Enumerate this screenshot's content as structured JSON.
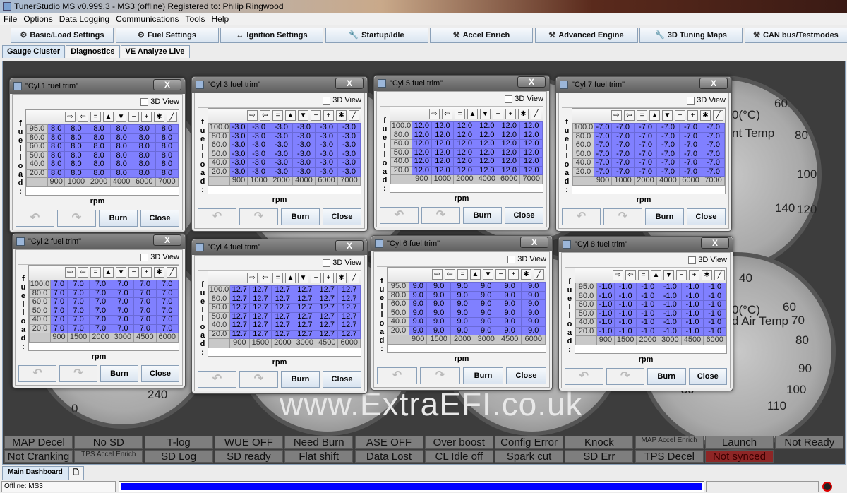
{
  "window_title": "TunerStudio MS v0.999.3 - MS3 (offline) Registered to: Philip Ringwood",
  "menu": [
    "File",
    "Options",
    "Data Logging",
    "Communications",
    "Tools",
    "Help"
  ],
  "toolbar": [
    {
      "label": "Basic/Load Settings",
      "icon": "engine-icon"
    },
    {
      "label": "Fuel Settings",
      "icon": "engine-icon"
    },
    {
      "label": "Ignition Settings",
      "icon": "spark-plug-icon"
    },
    {
      "label": "Startup/Idle",
      "icon": "wrench-icon"
    },
    {
      "label": "Accel Enrich",
      "icon": "tools-icon"
    },
    {
      "label": "Advanced Engine",
      "icon": "hammer-icon"
    },
    {
      "label": "3D Tuning Maps",
      "icon": "wrench-icon"
    },
    {
      "label": "CAN bus/Testmodes",
      "icon": "tools-icon"
    }
  ],
  "tabs": [
    "Gauge Cluster",
    "Diagnostics",
    "VE Analyze Live"
  ],
  "active_tab": "Gauge Cluster",
  "gauges": {
    "texts": [
      "60",
      "80",
      "100",
      "120",
      "140",
      "0(°C)",
      "nt Temp",
      "40",
      "60",
      "70",
      "80",
      "90",
      "100",
      "110",
      "-30",
      "0(°C)",
      "d Air Temp",
      "0",
      "240"
    ]
  },
  "watermark": "www.ExtraEFI.co.uk",
  "trim_common": {
    "view3d": "3D View",
    "xlabel": "rpm",
    "ylabel": "fuelload:",
    "burn": "Burn",
    "close": "Close",
    "close_x": "X",
    "tools": [
      "⇨",
      "⇦",
      "=",
      "▲",
      "▼",
      "−",
      "+",
      "✱",
      "╱"
    ]
  },
  "trims": [
    {
      "title": "\"Cyl 1 fuel trim\"",
      "loads": [
        "95.0",
        "80.0",
        "60.0",
        "50.0",
        "40.0",
        "20.0"
      ],
      "rpms": [
        "900",
        "1000",
        "2000",
        "4000",
        "6000",
        "7000"
      ],
      "value": "8.0"
    },
    {
      "title": "\"Cyl 3 fuel trim\"",
      "loads": [
        "100.0",
        "80.0",
        "60.0",
        "50.0",
        "40.0",
        "20.0"
      ],
      "rpms": [
        "900",
        "1000",
        "2000",
        "4000",
        "6000",
        "7000"
      ],
      "value": "-3.0"
    },
    {
      "title": "\"Cyl 5 fuel trim\"",
      "loads": [
        "100.0",
        "80.0",
        "60.0",
        "50.0",
        "40.0",
        "20.0"
      ],
      "rpms": [
        "900",
        "1000",
        "2000",
        "4000",
        "6000",
        "7000"
      ],
      "value": "12.0"
    },
    {
      "title": "\"Cyl 7 fuel trim\"",
      "loads": [
        "100.0",
        "80.0",
        "60.0",
        "50.0",
        "40.0",
        "20.0"
      ],
      "rpms": [
        "900",
        "1000",
        "2000",
        "4000",
        "6000",
        "7000"
      ],
      "value": "-7.0"
    },
    {
      "title": "\"Cyl 2 fuel trim\"",
      "loads": [
        "100.0",
        "80.0",
        "60.0",
        "50.0",
        "40.0",
        "20.0"
      ],
      "rpms": [
        "900",
        "1500",
        "2000",
        "3000",
        "4500",
        "6000"
      ],
      "value": "7.0"
    },
    {
      "title": "\"Cyl 4 fuel trim\"",
      "loads": [
        "100.0",
        "80.0",
        "60.0",
        "50.0",
        "40.0",
        "20.0"
      ],
      "rpms": [
        "900",
        "1500",
        "2000",
        "3000",
        "4500",
        "6000"
      ],
      "value": "12.7"
    },
    {
      "title": "\"Cyl 6 fuel trim\"",
      "loads": [
        "95.0",
        "80.0",
        "60.0",
        "50.0",
        "40.0",
        "20.0"
      ],
      "rpms": [
        "900",
        "1500",
        "2000",
        "3000",
        "4500",
        "6000"
      ],
      "value": "9.0"
    },
    {
      "title": "\"Cyl 8 fuel trim\"",
      "loads": [
        "95.0",
        "80.0",
        "60.0",
        "50.0",
        "40.0",
        "20.0"
      ],
      "rpms": [
        "900",
        "1500",
        "2000",
        "3000",
        "4500",
        "6000"
      ],
      "value": "-1.0"
    }
  ],
  "indicators": [
    [
      "MAP Decel",
      "No SD",
      "T-log",
      "WUE OFF",
      "Need Burn",
      "ASE OFF",
      "Over boost",
      "Config Error",
      "Knock",
      "MAP Accel Enrich",
      "Launch",
      "Not Ready"
    ],
    [
      "Not Cranking",
      "TPS Accel Enrich",
      "SD Log",
      "SD ready",
      "Flat shift",
      "Data Lost",
      "CL Idle off",
      "Spark cut",
      "SD Err",
      "TPS Decel",
      "Not synced",
      ""
    ]
  ],
  "indicator_colors": {
    "off": "#7e7e7e",
    "alert": "#8e2626"
  },
  "bottom_tabs": [
    "Main Dashboard"
  ],
  "status": {
    "text": "Offline: MS3",
    "progress": 1.0
  }
}
